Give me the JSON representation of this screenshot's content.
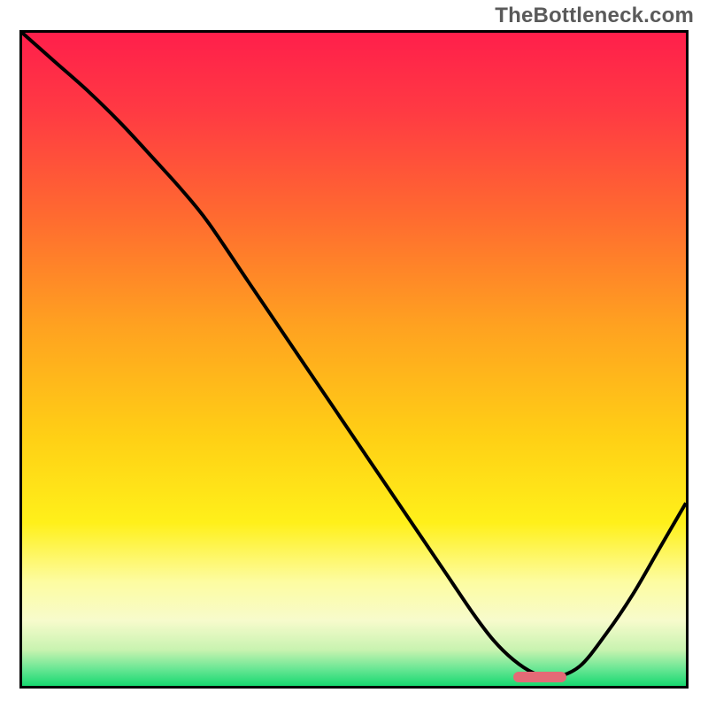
{
  "watermark": "TheBottleneck.com",
  "chart_data": {
    "type": "line",
    "title": "",
    "xlabel": "",
    "ylabel": "",
    "xlim": [
      0,
      100
    ],
    "ylim": [
      0,
      100
    ],
    "grid": false,
    "legend": false,
    "gradient_stops": [
      {
        "offset": 0.0,
        "color": "#ff1f4b"
      },
      {
        "offset": 0.12,
        "color": "#ff3a43"
      },
      {
        "offset": 0.28,
        "color": "#ff6a30"
      },
      {
        "offset": 0.45,
        "color": "#ffa220"
      },
      {
        "offset": 0.62,
        "color": "#ffd015"
      },
      {
        "offset": 0.75,
        "color": "#fff01a"
      },
      {
        "offset": 0.84,
        "color": "#fdfca0"
      },
      {
        "offset": 0.9,
        "color": "#f7fbcc"
      },
      {
        "offset": 0.945,
        "color": "#c8f3b0"
      },
      {
        "offset": 0.975,
        "color": "#66e693"
      },
      {
        "offset": 1.0,
        "color": "#17d86f"
      }
    ],
    "series": [
      {
        "name": "curve",
        "x": [
          0.0,
          5.0,
          10.0,
          15.0,
          20.0,
          24.0,
          28.0,
          34.0,
          40.0,
          46.0,
          52.0,
          58.0,
          64.0,
          68.0,
          71.0,
          74.0,
          77.0,
          80.0,
          84.0,
          88.0,
          92.0,
          96.0,
          100.0
        ],
        "y": [
          100.0,
          95.5,
          91.0,
          86.0,
          80.5,
          76.0,
          71.0,
          62.0,
          53.0,
          44.0,
          35.0,
          26.0,
          17.0,
          11.0,
          7.0,
          4.0,
          2.0,
          1.3,
          3.0,
          8.0,
          14.0,
          21.0,
          28.0
        ]
      }
    ],
    "marker": {
      "x_start": 74.0,
      "x_end": 82.0,
      "y": 1.3
    }
  }
}
